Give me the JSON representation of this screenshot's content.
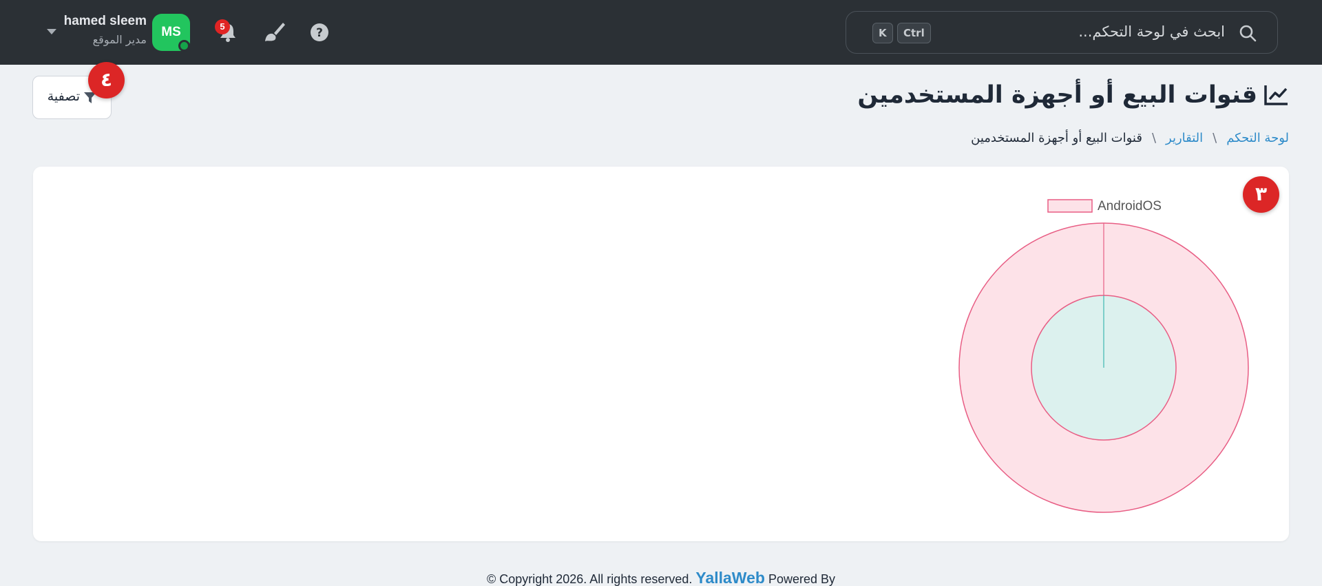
{
  "header": {
    "search": {
      "placeholder": "ابحث في لوحة التحكم...",
      "shortcut_ctrl": "Ctrl",
      "shortcut_k": "K"
    },
    "notifications_count": "5",
    "user": {
      "initials": "MS",
      "name": "hamed sleem",
      "role": "مدير الموقع"
    }
  },
  "page": {
    "title": "قنوات البيع أو أجهزة المستخدمين",
    "breadcrumb": [
      "لوحة التحكم",
      "التقارير",
      "قنوات البيع أو أجهزة المستخدمين"
    ],
    "filter_label": "تصفية",
    "step_badges": {
      "filter": "٤",
      "chart": "٣"
    }
  },
  "chart_data": {
    "type": "pie",
    "legend": [
      "AndroidOS"
    ],
    "legend_position": "top",
    "rings": [
      {
        "labels": [
          "AndroidOS"
        ],
        "values": [
          1
        ],
        "color": "#e85d84",
        "fill": "#fde2e8"
      },
      {
        "labels": [
          "AndroidOS"
        ],
        "values": [
          1
        ],
        "color": "#e85d84",
        "fill": "#dcf1ee"
      }
    ]
  },
  "colors": {
    "topbar": "#2b3035",
    "accent": "#2e8bc9",
    "avatar": "#22c55e",
    "badge": "#dc2626"
  },
  "footer": {
    "prefix": "Powered By",
    "brand": "YallaWeb",
    "suffix": "© Copyright 2026. All rights reserved."
  }
}
